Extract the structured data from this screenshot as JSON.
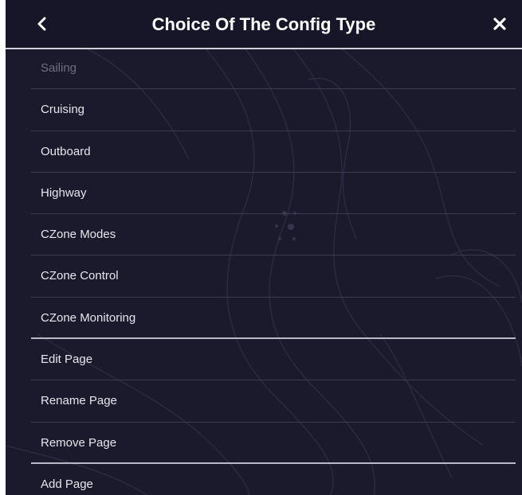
{
  "header": {
    "title": "Choice Of The Config Type",
    "back_icon": "chevron-left-icon",
    "close_icon": "close-icon"
  },
  "menu": {
    "items": [
      {
        "label": "Sailing",
        "enabled": false
      },
      {
        "label": "Cruising",
        "enabled": true
      },
      {
        "label": "Outboard",
        "enabled": true
      },
      {
        "label": "Highway",
        "enabled": true
      },
      {
        "label": "CZone Modes",
        "enabled": true
      },
      {
        "label": "CZone Control",
        "enabled": true
      },
      {
        "label": "CZone Monitoring",
        "enabled": true
      },
      {
        "label": "Edit Page",
        "enabled": true
      },
      {
        "label": "Rename Page",
        "enabled": true
      },
      {
        "label": "Remove Page",
        "enabled": true
      },
      {
        "label": "Add Page",
        "enabled": true
      }
    ]
  },
  "colors": {
    "background": "#1a1a2c",
    "text": "#e6e6ee",
    "disabled_text": "#6e6f82",
    "divider": "#3b3c52",
    "section_divider": "#b9bac8"
  }
}
